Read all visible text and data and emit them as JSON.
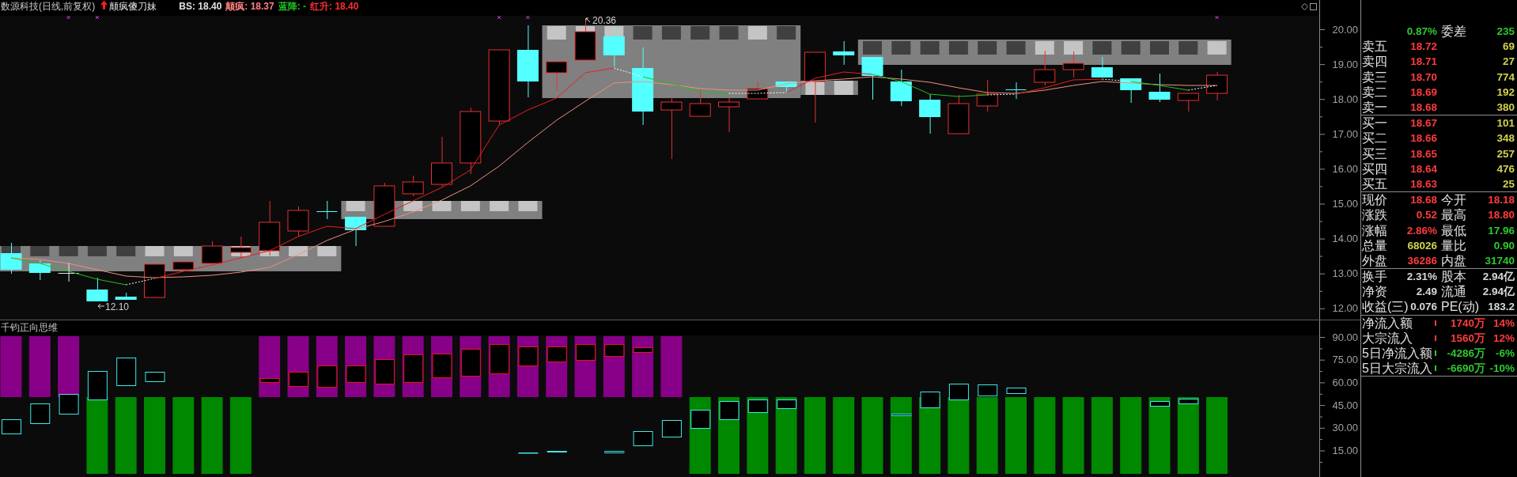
{
  "header": {
    "title": "数源科技(日线,前复权)",
    "indicator_name": "颠疯傻刀妹",
    "readouts": [
      {
        "text": "BS: 18.40",
        "color": "#e0e0e0"
      },
      {
        "text": "颠疯: 18.37",
        "color": "#ff8080"
      },
      {
        "text": "蓝降: -",
        "color": "#20c020"
      },
      {
        "text": "红升: 18.40",
        "color": "#ff3030"
      }
    ]
  },
  "price_chart": {
    "axis_labels": [
      "20.00",
      "19.00",
      "18.00",
      "17.00",
      "16.00",
      "15.00",
      "14.00",
      "13.00",
      "12.00"
    ],
    "high_label": "20.36",
    "low_label": "12.10"
  },
  "indicator_panel": {
    "title": "千钧正向思维",
    "axis_labels": [
      "90.00",
      "75.00",
      "60.00",
      "45.00",
      "30.00",
      "15.00"
    ]
  },
  "quote_panel": {
    "order_ratio": {
      "value": "0.87%",
      "diff_label": "委差",
      "diff_value": "235"
    },
    "asks": [
      {
        "label": "卖五",
        "price": "18.72",
        "volume": "69"
      },
      {
        "label": "卖四",
        "price": "18.71",
        "volume": "27"
      },
      {
        "label": "卖三",
        "price": "18.70",
        "volume": "774"
      },
      {
        "label": "卖二",
        "price": "18.69",
        "volume": "192"
      },
      {
        "label": "卖一",
        "price": "18.68",
        "volume": "380"
      }
    ],
    "bids": [
      {
        "label": "买一",
        "price": "18.67",
        "volume": "101"
      },
      {
        "label": "买二",
        "price": "18.66",
        "volume": "348"
      },
      {
        "label": "买三",
        "price": "18.65",
        "volume": "257"
      },
      {
        "label": "买四",
        "price": "18.64",
        "volume": "476"
      },
      {
        "label": "买五",
        "price": "18.63",
        "volume": "25"
      }
    ],
    "stats": [
      {
        "label": "现价",
        "value": "18.68",
        "color": "#ff3c3c"
      },
      {
        "label": "今开",
        "value": "18.18",
        "color": "#ff3c3c"
      },
      {
        "label": "涨跌",
        "value": "0.52",
        "color": "#ff3c3c"
      },
      {
        "label": "最高",
        "value": "18.80",
        "color": "#ff3c3c"
      },
      {
        "label": "涨幅",
        "value": "2.86%",
        "color": "#ff3c3c"
      },
      {
        "label": "最低",
        "value": "17.96",
        "color": "#2ec82e"
      },
      {
        "label": "总量",
        "value": "68026",
        "color": "#d2d250"
      },
      {
        "label": "量比",
        "value": "0.90",
        "color": "#2ec82e"
      },
      {
        "label": "外盘",
        "value": "36286",
        "color": "#ff3c3c"
      },
      {
        "label": "内盘",
        "value": "31740",
        "color": "#2ec82e"
      }
    ],
    "fundamentals": [
      {
        "label": "换手",
        "value": "2.31%"
      },
      {
        "label": "股本",
        "value": "2.94亿"
      },
      {
        "label": "净资",
        "value": "2.49"
      },
      {
        "label": "流通",
        "value": "2.94亿"
      },
      {
        "label": "收益(三)",
        "value": "0.076"
      },
      {
        "label": "PE(动)",
        "value": "183.2"
      }
    ],
    "flows": [
      {
        "label": "净流入额",
        "amount": "1740万",
        "percent": "14%",
        "color": "#ff3c3c"
      },
      {
        "label": "大宗流入",
        "amount": "1560万",
        "percent": "12%",
        "color": "#ff3c3c"
      },
      {
        "label": "5日净流入额",
        "amount": "-4286万",
        "percent": "-6%",
        "color": "#2ec82e"
      },
      {
        "label": "5日大宗流入",
        "amount": "-6690万",
        "percent": "-10%",
        "color": "#2ec82e"
      }
    ]
  }
}
